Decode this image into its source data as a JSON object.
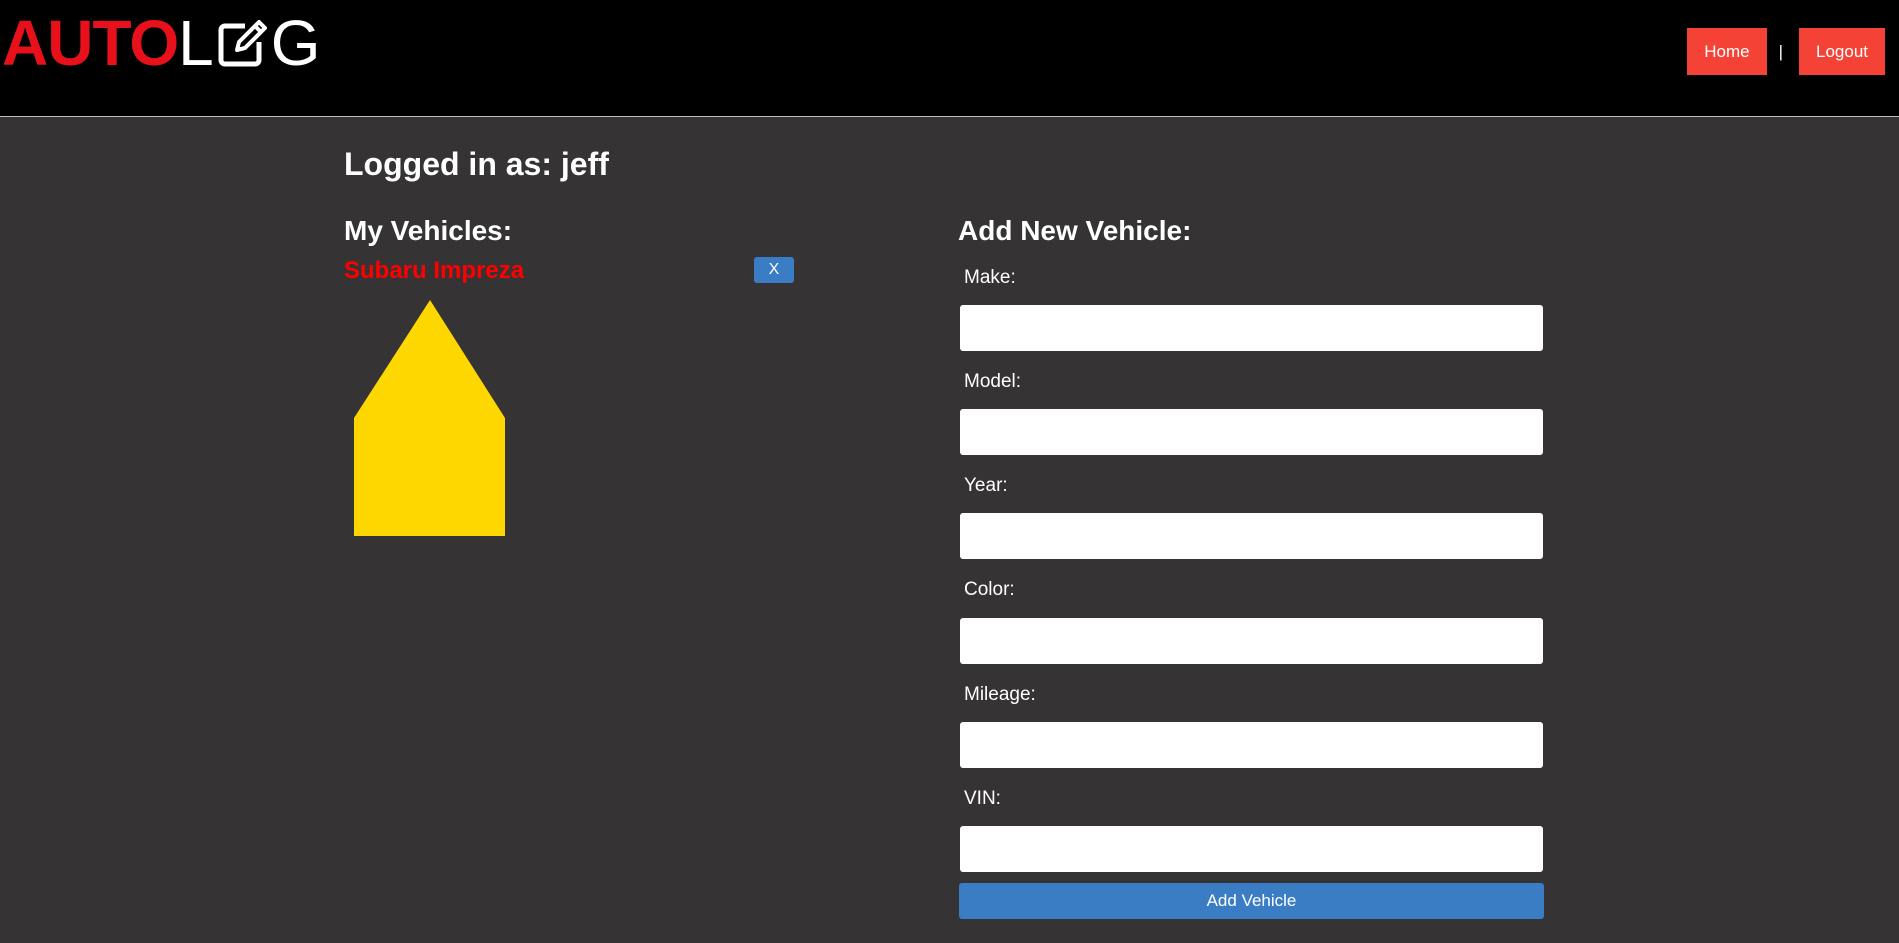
{
  "header": {
    "logo_auto": "AUTO",
    "logo_l": "L",
    "logo_g": "G",
    "logo_icon": "pencil-square-icon",
    "nav": {
      "home_label": "Home",
      "separator": "|",
      "logout_label": "Logout"
    }
  },
  "main": {
    "logged_in": "Logged in as: jeff",
    "vehicles": {
      "title": "My Vehicles:",
      "items": [
        {
          "name": "Subaru Impreza",
          "delete_label": "X",
          "image_icon": "car-silhouette-placeholder",
          "image_color": "#FFD700"
        }
      ]
    },
    "add_form": {
      "title": "Add New Vehicle:",
      "fields": [
        {
          "label": "Make:",
          "value": ""
        },
        {
          "label": "Model:",
          "value": ""
        },
        {
          "label": "Year:",
          "value": ""
        },
        {
          "label": "Color:",
          "value": ""
        },
        {
          "label": "Mileage:",
          "value": ""
        },
        {
          "label": "VIN:",
          "value": ""
        }
      ],
      "submit_label": "Add Vehicle"
    }
  },
  "colors": {
    "background": "#353334",
    "header": "#000000",
    "accent_red": "#F44336",
    "logo_red": "#E8111B",
    "button_blue": "#3B7DC4",
    "vehicle_name": "#FF0000"
  }
}
